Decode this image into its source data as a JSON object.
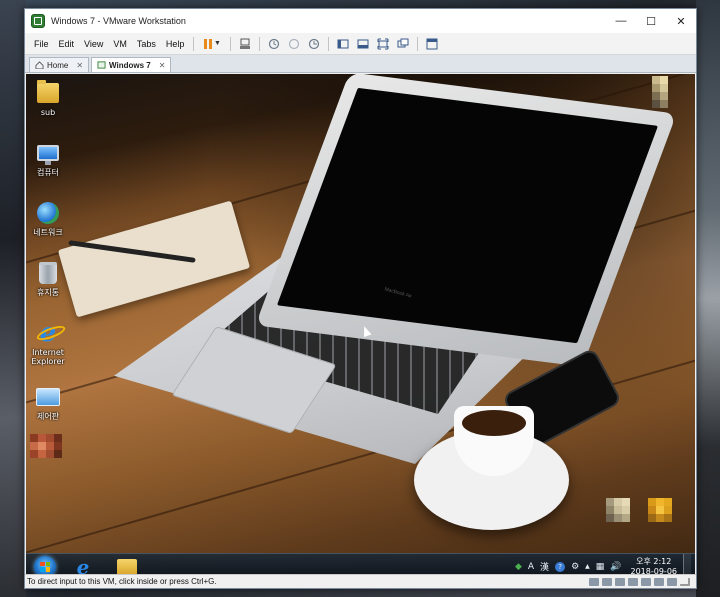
{
  "window": {
    "title": "Windows 7 - VMware Workstation",
    "minimize_glyph": "—",
    "maximize_glyph": "☐",
    "close_glyph": "✕"
  },
  "menu": {
    "items": [
      "File",
      "Edit",
      "View",
      "VM",
      "Tabs",
      "Help"
    ],
    "dropdown_caret": "▼"
  },
  "tabs": [
    {
      "label": "Home",
      "close": "✕",
      "active": false
    },
    {
      "label": "Windows 7",
      "close": "✕",
      "active": true
    }
  ],
  "desktop_icons": [
    {
      "label": "sub",
      "icon": "folder-icon"
    },
    {
      "label": "컴퓨터",
      "icon": "computer-icon"
    },
    {
      "label": "네트워크",
      "icon": "network-icon"
    },
    {
      "label": "휴지통",
      "icon": "recycle-bin-icon"
    },
    {
      "label": "Internet Explorer",
      "icon": "internet-explorer-icon"
    },
    {
      "label": "제어판",
      "icon": "control-panel-icon"
    }
  ],
  "laptop_brand": "MacBook Air",
  "taskbar": {
    "tray": {
      "input_mode": "A",
      "hanja": "漢",
      "help_glyph": "?",
      "show_hidden": "▲",
      "volume_glyph": "🔊"
    },
    "clock_time": "오후 2:12",
    "clock_date": "2018-09-06"
  },
  "statusbar": {
    "text": "To direct input to this VM, click inside or press Ctrl+G."
  },
  "colors": {
    "accent_pause": "#e88a1a",
    "vmware_green": "#2f7d32",
    "ie_blue": "#2a86e4"
  }
}
